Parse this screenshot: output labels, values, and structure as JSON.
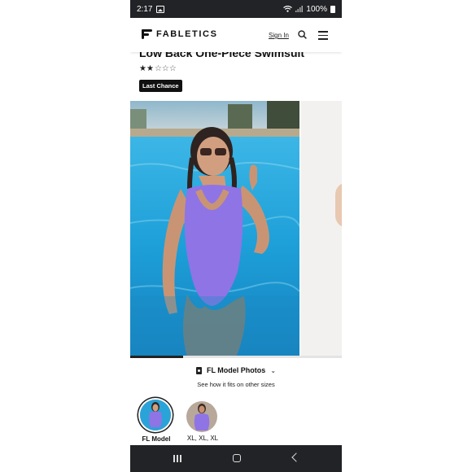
{
  "status_bar": {
    "time": "2:17",
    "battery": "100%",
    "icons": [
      "image-icon",
      "wifi-icon",
      "signal-icon",
      "battery-icon"
    ]
  },
  "header": {
    "brand": "FABLETICS",
    "sign_in": "Sign In",
    "icons": [
      "search-icon",
      "menu-icon"
    ]
  },
  "product": {
    "title": "Low Back One-Piece Swimsuit",
    "rating": 2,
    "rating_max": 5,
    "stars_filled": "★★",
    "stars_empty": "☆☆☆",
    "badge": "Last Chance"
  },
  "gallery": {
    "progress": 0.25,
    "swimsuit_color": "#8f74e6",
    "water_color": "#2ea6d9"
  },
  "model_photos": {
    "selector_label": "FL Model Photos",
    "subtitle": "See how it fits on other sizes",
    "thumbnails": [
      {
        "label": "FL Model Photos",
        "selected": true
      },
      {
        "label": "XL, XL, XL",
        "selected": false
      }
    ]
  },
  "nav_bar": {
    "icons": [
      "recent-apps-icon",
      "home-icon",
      "back-icon"
    ]
  }
}
